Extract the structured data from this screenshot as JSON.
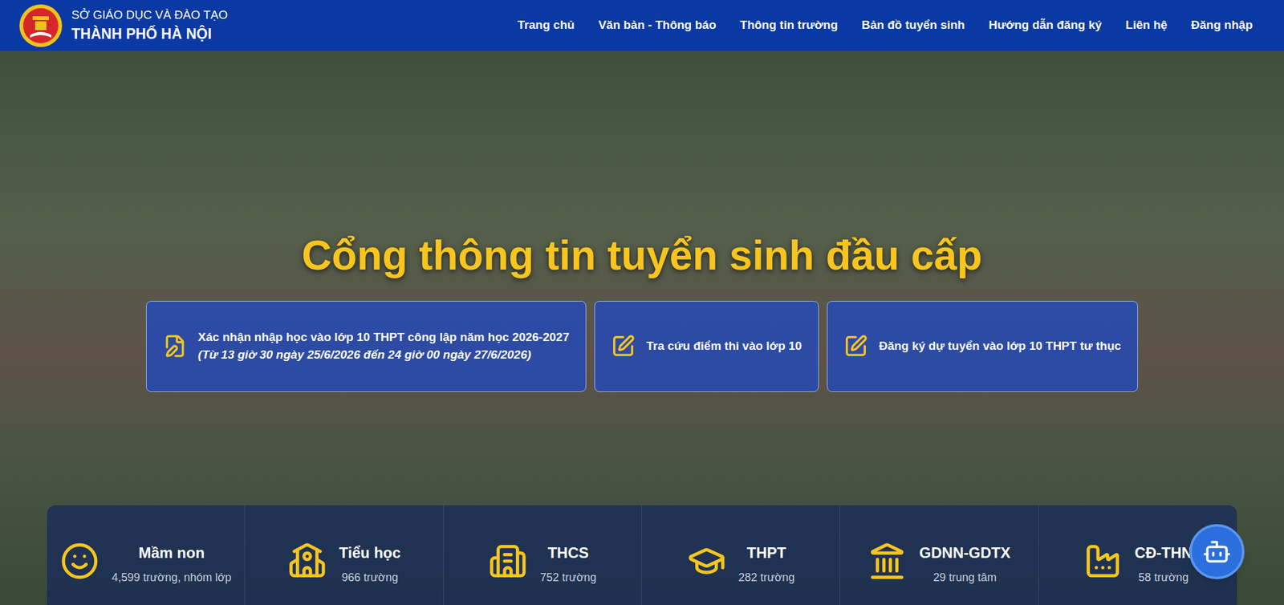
{
  "header": {
    "org_line1": "SỞ GIÁO DỤC VÀ ĐÀO TẠO",
    "org_line2": "THÀNH PHỐ HÀ NỘI",
    "nav": [
      "Trang chủ",
      "Văn bản - Thông báo",
      "Thông tin trường",
      "Bản đồ tuyển sinh",
      "Hướng dẫn đăng ký",
      "Liên hệ",
      "Đăng nhập"
    ]
  },
  "hero": {
    "title": "Cổng thông tin tuyển sinh đầu cấp"
  },
  "actions": [
    {
      "label": "Xác nhận nhập học vào lớp 10 THPT công lập năm học 2026-2027",
      "note": "(Từ 13 giờ 30 ngày 25/6/2026 đến 24 giờ 00 ngày 27/6/2026)"
    },
    {
      "label": "Tra cứu điểm thi vào lớp 10",
      "note": ""
    },
    {
      "label": "Đăng ký dự tuyển vào lớp 10 THPT tư thục",
      "note": ""
    }
  ],
  "stats": [
    {
      "name": "Mầm non",
      "count": "4,599 trường, nhóm lớp"
    },
    {
      "name": "Tiểu học",
      "count": "966 trường"
    },
    {
      "name": "THCS",
      "count": "752 trường"
    },
    {
      "name": "THPT",
      "count": "282 trường"
    },
    {
      "name": "GDNN-GDTX",
      "count": "29 trung tâm"
    },
    {
      "name": "CĐ-THN",
      "count": "58 trường"
    }
  ]
}
